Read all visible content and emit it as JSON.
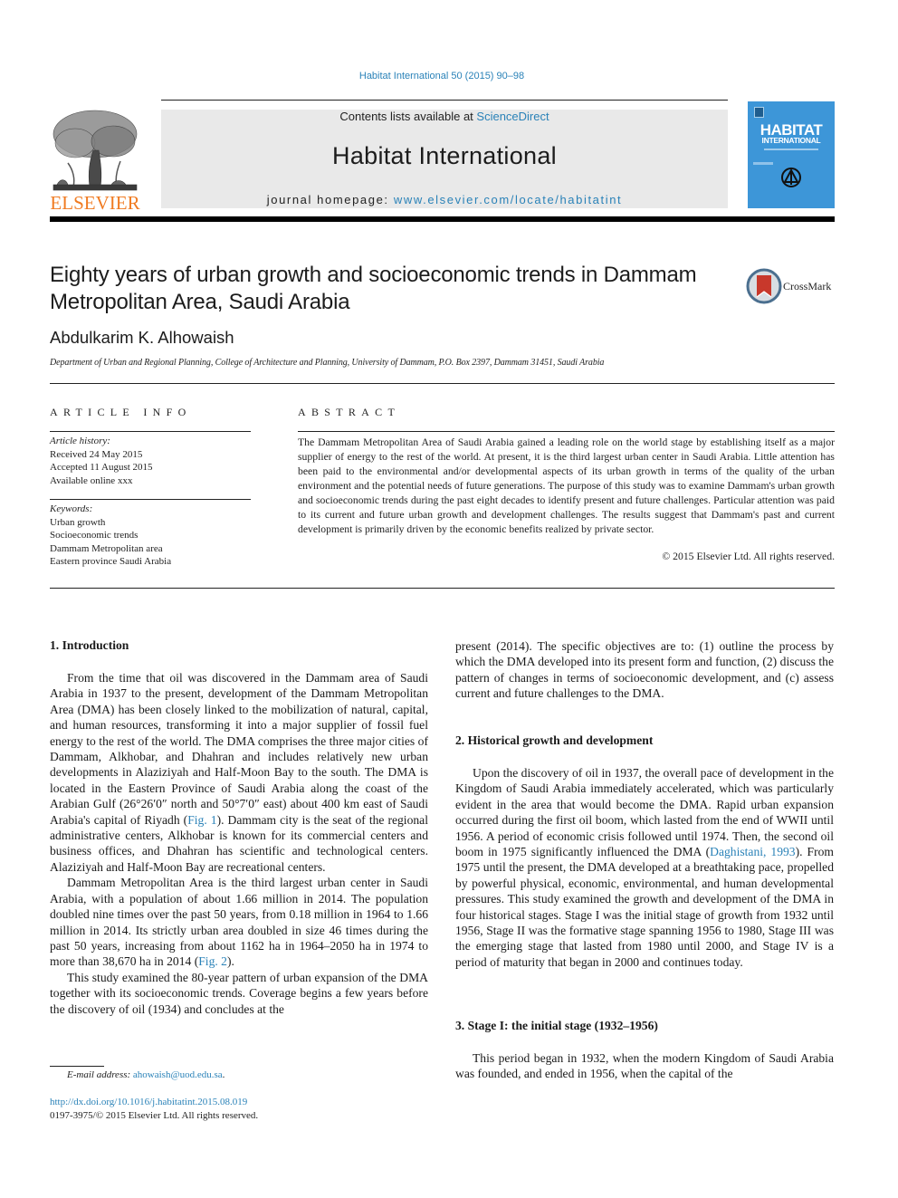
{
  "header": {
    "running_head": "Habitat International 50 (2015) 90–98",
    "contents_prefix": "Contents lists available at ",
    "contents_link": "ScienceDirect",
    "journal_name": "Habitat International",
    "homepage_prefix": "journal homepage: ",
    "homepage_link": "www.elsevier.com/locate/habitatint",
    "publisher_logo_text": "ELSEVIER",
    "cover": {
      "title_line1": "HABITAT",
      "title_line2": "INTERNATIONAL",
      "color": "#3d96d8"
    },
    "accent_color": "#2a82b8",
    "publisher_color": "#f07b22"
  },
  "article": {
    "title": "Eighty years of urban growth and socioeconomic trends in Dammam Metropolitan Area, Saudi Arabia",
    "crossmark_label": "CrossMark",
    "author": "Abdulkarim K. Alhowaish",
    "affiliation": "Department of Urban and Regional Planning, College of Architecture and Planning, University of Dammam, P.O. Box 2397, Dammam 31451, Saudi Arabia"
  },
  "article_info": {
    "label": "ARTICLE INFO",
    "history_label": "Article history:",
    "history": [
      "Received 24 May 2015",
      "Accepted 11 August 2015",
      "Available online xxx"
    ],
    "keywords_label": "Keywords:",
    "keywords": [
      "Urban growth",
      "Socioeconomic trends",
      "Dammam Metropolitan area",
      "Eastern province Saudi Arabia"
    ]
  },
  "abstract": {
    "label": "ABSTRACT",
    "text": "The Dammam Metropolitan Area of Saudi Arabia gained a leading role on the world stage by establishing itself as a major supplier of energy to the rest of the world. At present, it is the third largest urban center in Saudi Arabia. Little attention has been paid to the environmental and/or developmental aspects of its urban growth in terms of the quality of the urban environment and the potential needs of future generations. The purpose of this study was to examine Dammam's urban growth and socioeconomic trends during the past eight decades to identify present and future challenges. Particular attention was paid to its current and future urban growth and development challenges. The results suggest that Dammam's past and current development is primarily driven by the economic benefits realized by private sector.",
    "copyright": "© 2015 Elsevier Ltd. All rights reserved."
  },
  "body": {
    "sec1_heading": "1.  Introduction",
    "sec1_p1_a": "From the time that oil was discovered in the Dammam area of Saudi Arabia in 1937 to the present, development of the Dammam Metropolitan Area (DMA) has been closely linked to the mobilization of natural, capital, and human resources, transforming it into a major supplier of fossil fuel energy to the rest of the world. The DMA comprises the three major cities of Dammam, Alkhobar, and Dhahran and includes relatively new urban developments in Alaziziyah and Half-Moon Bay to the south. The DMA is located in the Eastern Province of Saudi Arabia along the coast of the Arabian Gulf (26°26′0″ north and 50°7′0″ east) about 400 km east of Saudi Arabia's capital of Riyadh (",
    "sec1_p1_link": "Fig. 1",
    "sec1_p1_b": "). Dammam city is the seat of the regional administrative centers, Alkhobar is known for its commercial centers and business offices, and Dhahran has scientific and technological centers. Alaziziyah and Half-Moon Bay are recreational centers.",
    "sec1_p2_a": "Dammam Metropolitan Area is the third largest urban center in Saudi Arabia, with a population of about 1.66 million in 2014. The population doubled nine times over the past 50 years, from 0.18 million in 1964 to 1.66 million in 2014. Its strictly urban area doubled in size 46 times during the past 50 years, increasing from about 1162 ha in 1964–2050 ha in 1974 to more than 38,670 ha in 2014 (",
    "sec1_p2_link": "Fig. 2",
    "sec1_p2_b": ").",
    "sec1_p3": "This study examined the 80-year pattern of urban expansion of the DMA together with its socioeconomic trends. Coverage begins a few years before the discovery of oil (1934) and concludes at the present (2014). The specific objectives are to: (1) outline the process by which the DMA developed into its present form and function, (2) discuss the pattern of changes in terms of socioeconomic development, and (c) assess current and future challenges to the DMA.",
    "sec1_p3_col1": "This study examined the 80-year pattern of urban expansion of the DMA together with its socioeconomic trends. Coverage begins a few years before the discovery of oil (1934) and concludes at the",
    "sec1_p3_col2": "present (2014). The specific objectives are to: (1) outline the process by which the DMA developed into its present form and function, (2) discuss the pattern of changes in terms of socioeconomic development, and (c) assess current and future challenges to the DMA.",
    "sec2_heading": "2.  Historical growth and development",
    "sec2_p1_a": "Upon the discovery of oil in 1937, the overall pace of development in the Kingdom of Saudi Arabia immediately accelerated, which was particularly evident in the area that would become the DMA. Rapid urban expansion occurred during the first oil boom, which lasted from the end of WWII until 1956. A period of economic crisis followed until 1974. Then, the second oil boom in 1975 significantly influenced the DMA (",
    "sec2_p1_link": "Daghistani, 1993",
    "sec2_p1_b": "). From 1975 until the present, the DMA developed at a breathtaking pace, propelled by powerful physical, economic, environmental, and human developmental pressures. This study examined the growth and development of the DMA in four historical stages. Stage I was the initial stage of growth from 1932 until 1956, Stage II was the formative stage spanning 1956 to 1980, Stage III was the emerging stage that lasted from 1980 until 2000, and Stage IV is a period of maturity that began in 2000 and continues today.",
    "sec3_heading": "3.  Stage I: the initial stage (1932–1956)",
    "sec3_p1": "This period began in 1932, when the modern Kingdom of Saudi Arabia was founded, and ended in 1956, when the capital of the"
  },
  "footer": {
    "email_label": "E-mail address: ",
    "email": "ahowaish@uod.edu.sa",
    "email_suffix": ".",
    "doi": "http://dx.doi.org/10.1016/j.habitatint.2015.08.019",
    "issn": "0197-3975/© 2015 Elsevier Ltd. All rights reserved."
  }
}
